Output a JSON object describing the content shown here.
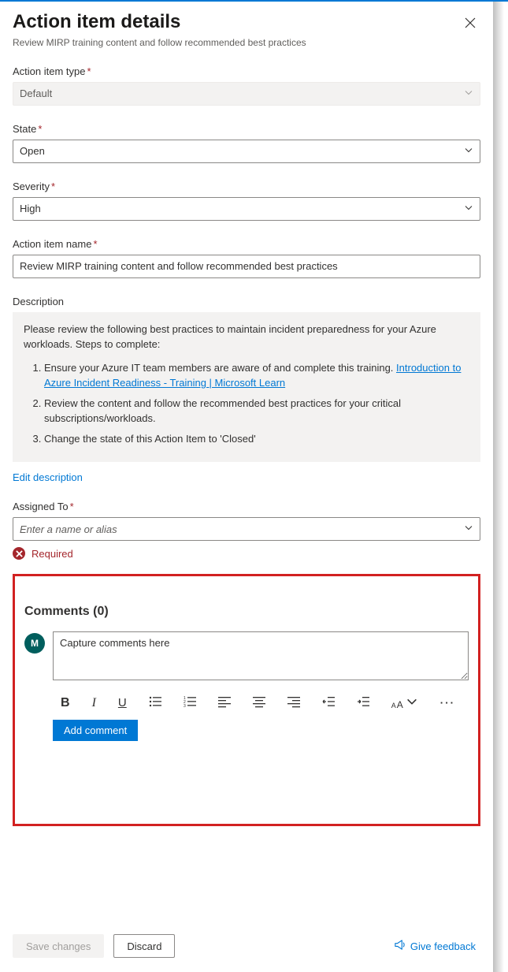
{
  "header": {
    "title": "Action item details",
    "subtitle": "Review MIRP training content and follow recommended best practices"
  },
  "fields": {
    "type": {
      "label": "Action item type",
      "value": "Default",
      "required": true
    },
    "state": {
      "label": "State",
      "value": "Open",
      "required": true
    },
    "severity": {
      "label": "Severity",
      "value": "High",
      "required": true
    },
    "name": {
      "label": "Action item name",
      "value": "Review MIRP training content and follow recommended best practices",
      "required": true
    },
    "description": {
      "label": "Description",
      "intro": "Please review the following best practices to maintain incident preparedness for your Azure workloads. Steps to complete:",
      "steps": {
        "s1_pre": "Ensure your Azure IT team members are aware of and complete this training. ",
        "s1_link": "Introduction to Azure Incident Readiness - Training | Microsoft Learn",
        "s2": "Review the content and follow the recommended best practices for your critical subscriptions/workloads.",
        "s3": "Change the state of this Action Item to 'Closed'"
      },
      "edit_label": "Edit description"
    },
    "assigned": {
      "label": "Assigned To",
      "placeholder": "Enter a name or alias",
      "required": true,
      "error": "Required"
    }
  },
  "comments": {
    "heading": "Comments (0)",
    "avatar_initial": "M",
    "placeholder": "Capture comments here",
    "add_label": "Add comment"
  },
  "footer": {
    "save": "Save changes",
    "discard": "Discard",
    "feedback": "Give feedback"
  }
}
